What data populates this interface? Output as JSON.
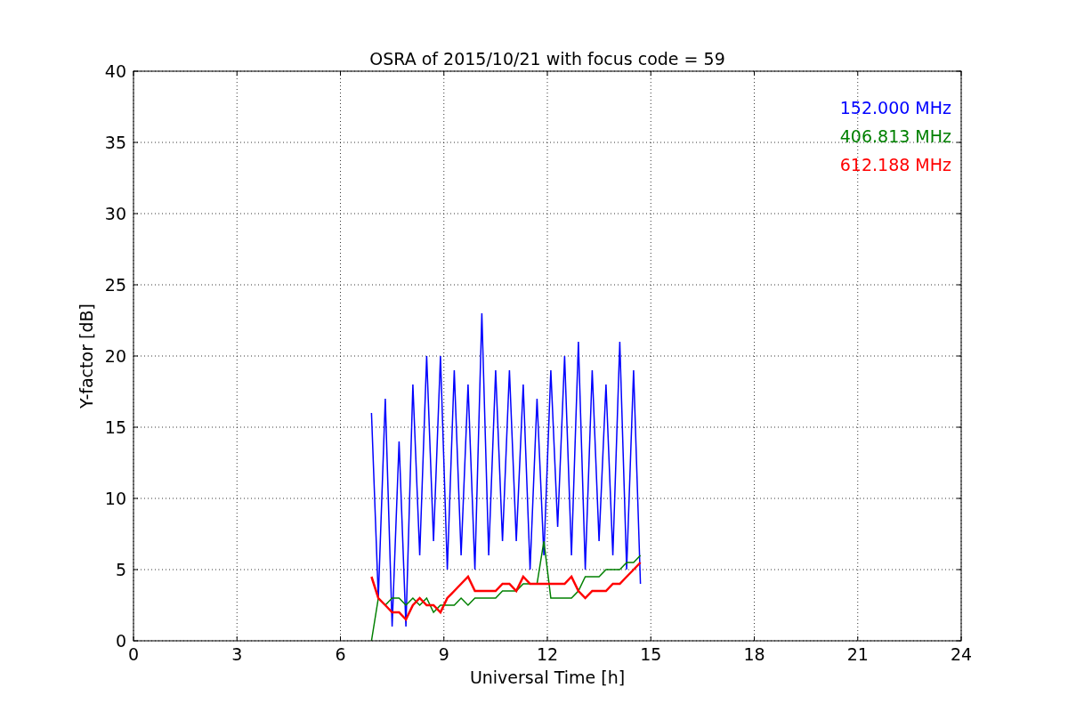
{
  "chart_data": {
    "type": "line",
    "title": "OSRA of 2015/10/21 with focus code = 59",
    "xlabel": "Universal Time [h]",
    "ylabel": "Y-factor [dB]",
    "x": [
      6.9,
      7.1,
      7.3,
      7.5,
      7.7,
      7.9,
      8.1,
      8.3,
      8.5,
      8.7,
      8.9,
      9.1,
      9.3,
      9.5,
      9.7,
      9.9,
      10.1,
      10.3,
      10.5,
      10.7,
      10.9,
      11.1,
      11.3,
      11.5,
      11.7,
      11.9,
      12.1,
      12.3,
      12.5,
      12.7,
      12.9,
      13.1,
      13.3,
      13.5,
      13.7,
      13.9,
      14.1,
      14.3,
      14.5,
      14.7
    ],
    "series": [
      {
        "name": "152.000 MHz",
        "color": "#0000ff",
        "values": [
          16,
          3,
          17,
          1,
          14,
          1,
          18,
          6,
          20,
          7,
          20,
          5,
          19,
          6,
          18,
          5,
          23,
          6,
          19,
          7,
          19,
          7,
          18,
          5,
          17,
          6,
          19,
          8,
          20,
          6,
          21,
          5,
          19,
          7,
          18,
          6,
          21,
          5,
          19,
          4
        ]
      },
      {
        "name": "406.813 MHz",
        "color": "#008000",
        "values": [
          0,
          3,
          2.5,
          3,
          3,
          2.5,
          3,
          2.5,
          3,
          2,
          2.5,
          2.5,
          2.5,
          3,
          2.5,
          3,
          3,
          3,
          3,
          3.5,
          3.5,
          3.5,
          4,
          4,
          4,
          7,
          3,
          3,
          3,
          3,
          3.5,
          4.5,
          4.5,
          4.5,
          5,
          5,
          5,
          5.5,
          5.5,
          6
        ]
      },
      {
        "name": "612.188 MHz",
        "color": "#ff0000",
        "values": [
          4.5,
          3,
          2.5,
          2,
          2,
          1.5,
          2.5,
          3,
          2.5,
          2.5,
          2,
          3,
          3.5,
          4,
          4.5,
          3.5,
          3.5,
          3.5,
          3.5,
          4,
          4,
          3.5,
          4.5,
          4,
          4,
          4,
          4,
          4,
          4,
          4.5,
          3.5,
          3,
          3.5,
          3.5,
          3.5,
          4,
          4,
          4.5,
          5,
          5.5
        ]
      }
    ],
    "xlim": [
      0,
      24
    ],
    "ylim": [
      0,
      40
    ],
    "xticks": [
      0,
      3,
      6,
      9,
      12,
      15,
      18,
      21,
      24
    ],
    "yticks": [
      0,
      5,
      10,
      15,
      20,
      25,
      30,
      35,
      40
    ],
    "grid": true
  }
}
